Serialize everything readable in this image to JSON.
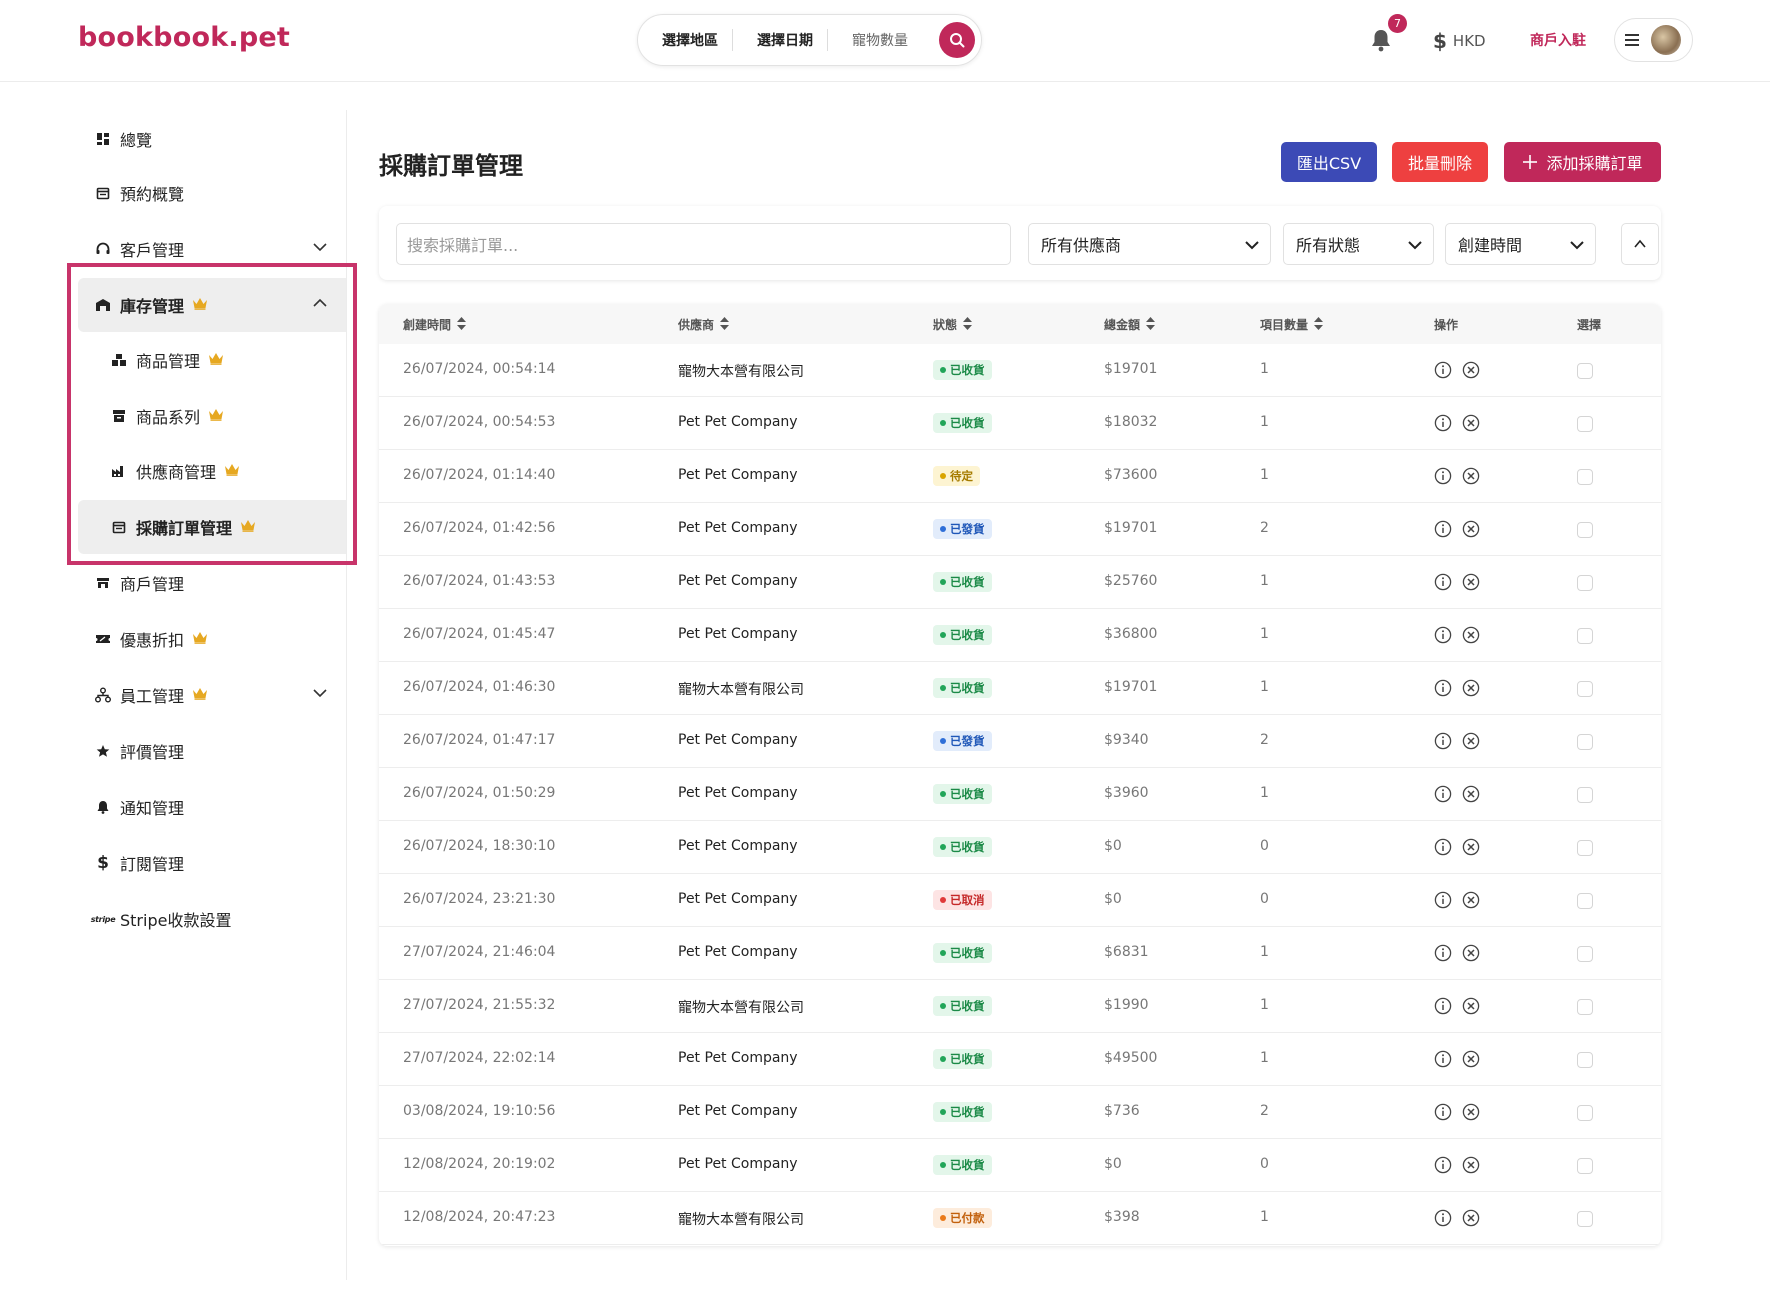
{
  "header": {
    "logo": "bookbook.pet",
    "search": {
      "region": "選擇地區",
      "date": "選擇日期",
      "pets": "寵物數量"
    },
    "notifications_count": "7",
    "currency": "HKD",
    "merchant_link": "商戶入駐"
  },
  "sidebar": {
    "items": [
      {
        "label": "總覽",
        "icon": "dashboard-icon"
      },
      {
        "label": "預約概覽",
        "icon": "calendar-icon"
      },
      {
        "label": "客戶管理",
        "icon": "headset-icon",
        "expandable": true
      },
      {
        "label": "庫存管理",
        "icon": "store-icon",
        "premium": true,
        "expanded": true,
        "active": true
      },
      {
        "label": "商品管理",
        "icon": "boxes-icon",
        "premium": true,
        "sub": true
      },
      {
        "label": "商品系列",
        "icon": "archive-icon",
        "premium": true,
        "sub": true
      },
      {
        "label": "供應商管理",
        "icon": "factory-icon",
        "premium": true,
        "sub": true
      },
      {
        "label": "採購訂單管理",
        "icon": "calendar-icon",
        "premium": true,
        "sub": true,
        "active": true
      },
      {
        "label": "商戶管理",
        "icon": "shop-icon"
      },
      {
        "label": "優惠折扣",
        "icon": "ticket-icon",
        "premium": true
      },
      {
        "label": "員工管理",
        "icon": "org-icon",
        "premium": true,
        "expandable": true
      },
      {
        "label": "評價管理",
        "icon": "star-icon"
      },
      {
        "label": "通知管理",
        "icon": "bell-icon"
      },
      {
        "label": "訂閱管理",
        "icon": "dollar-icon"
      },
      {
        "label": "Stripe收款設置",
        "icon": "stripe-icon"
      }
    ]
  },
  "main": {
    "title": "採購訂單管理",
    "buttons": {
      "export_csv": "匯出CSV",
      "bulk_delete": "批量刪除",
      "add_order": "添加採購訂單"
    },
    "filters": {
      "search_placeholder": "搜索採購訂單...",
      "supplier": "所有供應商",
      "status": "所有狀態",
      "sort": "創建時間"
    },
    "table": {
      "headers": [
        "創建時間",
        "供應商",
        "狀態",
        "總金額",
        "項目數量",
        "操作",
        "選擇"
      ],
      "rows": [
        {
          "date": "26/07/2024, 00:54:14",
          "supplier": "寵物大本營有限公司",
          "status": "已收貨",
          "kind": "received",
          "total": "$19701",
          "qty": "1"
        },
        {
          "date": "26/07/2024, 00:54:53",
          "supplier": "Pet Pet Company",
          "status": "已收貨",
          "kind": "received",
          "total": "$18032",
          "qty": "1"
        },
        {
          "date": "26/07/2024, 01:14:40",
          "supplier": "Pet Pet Company",
          "status": "待定",
          "kind": "pending",
          "total": "$73600",
          "qty": "1"
        },
        {
          "date": "26/07/2024, 01:42:56",
          "supplier": "Pet Pet Company",
          "status": "已發貨",
          "kind": "shipped",
          "total": "$19701",
          "qty": "2"
        },
        {
          "date": "26/07/2024, 01:43:53",
          "supplier": "Pet Pet Company",
          "status": "已收貨",
          "kind": "received",
          "total": "$25760",
          "qty": "1"
        },
        {
          "date": "26/07/2024, 01:45:47",
          "supplier": "Pet Pet Company",
          "status": "已收貨",
          "kind": "received",
          "total": "$36800",
          "qty": "1"
        },
        {
          "date": "26/07/2024, 01:46:30",
          "supplier": "寵物大本營有限公司",
          "status": "已收貨",
          "kind": "received",
          "total": "$19701",
          "qty": "1"
        },
        {
          "date": "26/07/2024, 01:47:17",
          "supplier": "Pet Pet Company",
          "status": "已發貨",
          "kind": "shipped",
          "total": "$9340",
          "qty": "2"
        },
        {
          "date": "26/07/2024, 01:50:29",
          "supplier": "Pet Pet Company",
          "status": "已收貨",
          "kind": "received",
          "total": "$3960",
          "qty": "1"
        },
        {
          "date": "26/07/2024, 18:30:10",
          "supplier": "Pet Pet Company",
          "status": "已收貨",
          "kind": "received",
          "total": "$0",
          "qty": "0"
        },
        {
          "date": "26/07/2024, 23:21:30",
          "supplier": "Pet Pet Company",
          "status": "已取消",
          "kind": "cancelled",
          "total": "$0",
          "qty": "0"
        },
        {
          "date": "27/07/2024, 21:46:04",
          "supplier": "Pet Pet Company",
          "status": "已收貨",
          "kind": "received",
          "total": "$6831",
          "qty": "1"
        },
        {
          "date": "27/07/2024, 21:55:32",
          "supplier": "寵物大本營有限公司",
          "status": "已收貨",
          "kind": "received",
          "total": "$1990",
          "qty": "1"
        },
        {
          "date": "27/07/2024, 22:02:14",
          "supplier": "Pet Pet Company",
          "status": "已收貨",
          "kind": "received",
          "total": "$49500",
          "qty": "1"
        },
        {
          "date": "03/08/2024, 19:10:56",
          "supplier": "Pet Pet Company",
          "status": "已收貨",
          "kind": "received",
          "total": "$736",
          "qty": "2"
        },
        {
          "date": "12/08/2024, 20:19:02",
          "supplier": "Pet Pet Company",
          "status": "已收貨",
          "kind": "received",
          "total": "$0",
          "qty": "0"
        },
        {
          "date": "12/08/2024, 20:47:23",
          "supplier": "寵物大本營有限公司",
          "status": "已付款",
          "kind": "paid",
          "total": "$398",
          "qty": "1"
        }
      ]
    }
  },
  "colors": {
    "brand": "#c0285a",
    "csv_button": "#3c4ab6",
    "delete_button": "#ee4040",
    "received": "#22a559",
    "pending": "#d9a400",
    "shipped": "#2f6fd8",
    "cancelled": "#e03b3b",
    "paid": "#ea7a1a"
  }
}
